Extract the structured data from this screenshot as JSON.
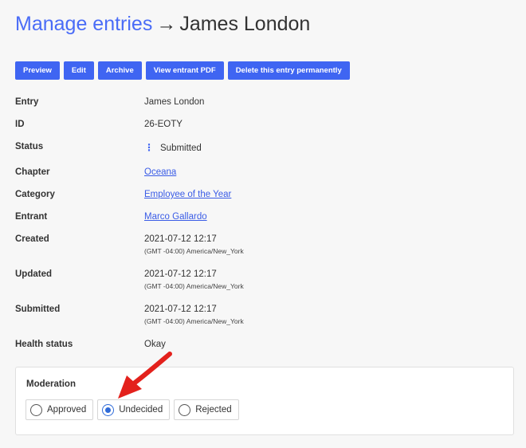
{
  "header": {
    "breadcrumb": "Manage entries",
    "arrow": "→",
    "entry_name": "James London"
  },
  "toolbar": {
    "preview": "Preview",
    "edit": "Edit",
    "archive": "Archive",
    "view_pdf": "View entrant PDF",
    "delete": "Delete this entry permanently"
  },
  "details": {
    "entry": {
      "label": "Entry",
      "value": "James London"
    },
    "id": {
      "label": "ID",
      "value": "26-EOTY"
    },
    "status": {
      "label": "Status",
      "value": "Submitted",
      "icon": "vertical-dots-icon"
    },
    "chapter": {
      "label": "Chapter",
      "value": "Oceana"
    },
    "category": {
      "label": "Category",
      "value": "Employee of the Year"
    },
    "entrant": {
      "label": "Entrant",
      "value": "Marco Gallardo"
    },
    "created": {
      "label": "Created",
      "value": "2021-07-12 12:17",
      "tz": "(GMT -04:00) America/New_York"
    },
    "updated": {
      "label": "Updated",
      "value": "2021-07-12 12:17",
      "tz": "(GMT -04:00) America/New_York"
    },
    "submitted": {
      "label": "Submitted",
      "value": "2021-07-12 12:17",
      "tz": "(GMT -04:00) America/New_York"
    },
    "health": {
      "label": "Health status",
      "value": "Okay"
    }
  },
  "moderation": {
    "title": "Moderation",
    "options": [
      "Approved",
      "Undecided",
      "Rejected"
    ],
    "selected": "Undecided"
  },
  "colors": {
    "accent": "#3f65f2",
    "link": "#3a5ce6",
    "annotation": "#e3211c"
  }
}
